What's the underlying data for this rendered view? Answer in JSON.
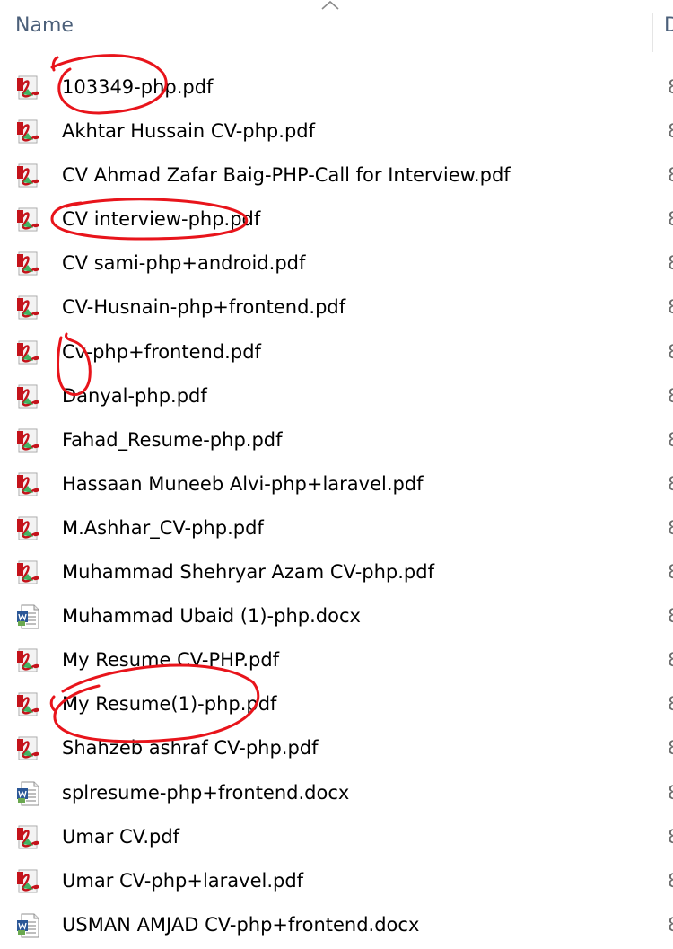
{
  "header": {
    "name_label": "Name",
    "next_column_label": "D"
  },
  "colors": {
    "header_text": "#4c607a",
    "annotation_red": "#e8141b",
    "pdf_icon_red": "#c4131b",
    "docx_icon_blue": "#2b5797"
  },
  "files": [
    {
      "name": "103349-php.pdf",
      "type": "pdf",
      "icon": "pdf-file-icon",
      "next_col": "8"
    },
    {
      "name": "Akhtar Hussain CV-php.pdf",
      "type": "pdf",
      "icon": "pdf-file-icon",
      "next_col": "8"
    },
    {
      "name": "CV Ahmad Zafar Baig-PHP-Call for Interview.pdf",
      "type": "pdf",
      "icon": "pdf-file-icon",
      "next_col": "8"
    },
    {
      "name": "CV interview-php.pdf",
      "type": "pdf",
      "icon": "pdf-file-icon",
      "next_col": "8"
    },
    {
      "name": "CV sami-php+android.pdf",
      "type": "pdf",
      "icon": "pdf-file-icon",
      "next_col": "8"
    },
    {
      "name": "CV-Husnain-php+frontend.pdf",
      "type": "pdf",
      "icon": "pdf-file-icon",
      "next_col": "8"
    },
    {
      "name": "Cv-php+frontend.pdf",
      "type": "pdf",
      "icon": "pdf-file-icon",
      "next_col": "8"
    },
    {
      "name": "Danyal-php.pdf",
      "type": "pdf",
      "icon": "pdf-file-icon",
      "next_col": "8"
    },
    {
      "name": "Fahad_Resume-php.pdf",
      "type": "pdf",
      "icon": "pdf-file-icon",
      "next_col": "8"
    },
    {
      "name": "Hassaan Muneeb Alvi-php+laravel.pdf",
      "type": "pdf",
      "icon": "pdf-file-icon",
      "next_col": "8"
    },
    {
      "name": "M.Ashhar_CV-php.pdf",
      "type": "pdf",
      "icon": "pdf-file-icon",
      "next_col": "8"
    },
    {
      "name": "Muhammad Shehryar Azam CV-php.pdf",
      "type": "pdf",
      "icon": "pdf-file-icon",
      "next_col": "8"
    },
    {
      "name": "Muhammad Ubaid (1)-php.docx",
      "type": "docx",
      "icon": "word-document-icon",
      "next_col": "8"
    },
    {
      "name": "My Resume CV-PHP.pdf",
      "type": "pdf",
      "icon": "pdf-file-icon",
      "next_col": "8"
    },
    {
      "name": "My Resume(1)-php.pdf",
      "type": "pdf",
      "icon": "pdf-file-icon",
      "next_col": "8"
    },
    {
      "name": "Shahzeb ashraf CV-php.pdf",
      "type": "pdf",
      "icon": "pdf-file-icon",
      "next_col": "8"
    },
    {
      "name": "splresume-php+frontend.docx",
      "type": "docx",
      "icon": "word-document-icon",
      "next_col": "8"
    },
    {
      "name": "Umar CV.pdf",
      "type": "pdf",
      "icon": "pdf-file-icon",
      "next_col": "8"
    },
    {
      "name": "Umar CV-php+laravel.pdf",
      "type": "pdf",
      "icon": "pdf-file-icon",
      "next_col": "8"
    },
    {
      "name": "USMAN AMJAD CV-php+frontend.docx",
      "type": "docx",
      "icon": "word-document-icon",
      "next_col": "8"
    }
  ]
}
